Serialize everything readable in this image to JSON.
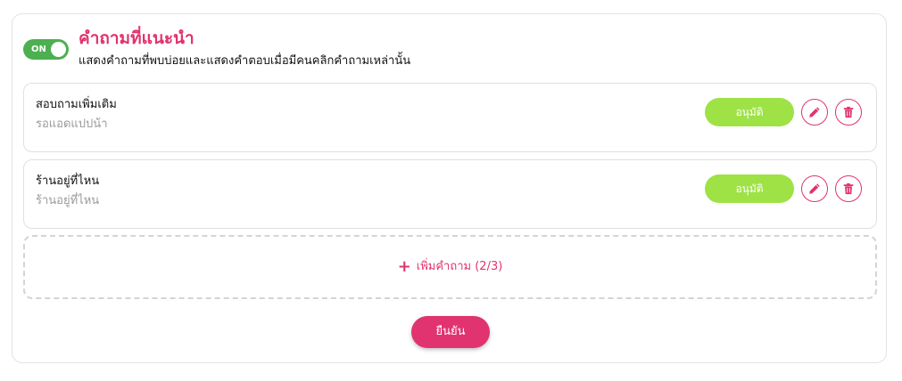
{
  "header": {
    "toggle_label": "ON",
    "toggle_on": true,
    "title": "คำถามที่แนะนำ",
    "subtitle": "แสดงคำถามที่พบบ่อยและแสดงคำตอบเมื่อมีคนคลิกคำถามเหล่านั้น"
  },
  "questions": [
    {
      "question": "สอบถามเพิ่มเติม",
      "answer": "รอแอดแปปน้า",
      "approve_label": "อนุมัติ",
      "edit_icon": "pencil-icon",
      "delete_icon": "trash-icon"
    },
    {
      "question": "ร้านอยู่ที่ไหน",
      "answer": "ร้านอยู่ที่ไหน",
      "approve_label": "อนุมัติ",
      "edit_icon": "pencil-icon",
      "delete_icon": "trash-icon"
    }
  ],
  "add_question": {
    "plus": "+",
    "label": "เพิ่มคำถาม (2/3)"
  },
  "confirm_label": "ยืนยัน",
  "colors": {
    "accent": "#e0336f",
    "toggle_on": "#4caf50",
    "approve": "#9ee246",
    "border": "#e0e0e0"
  }
}
